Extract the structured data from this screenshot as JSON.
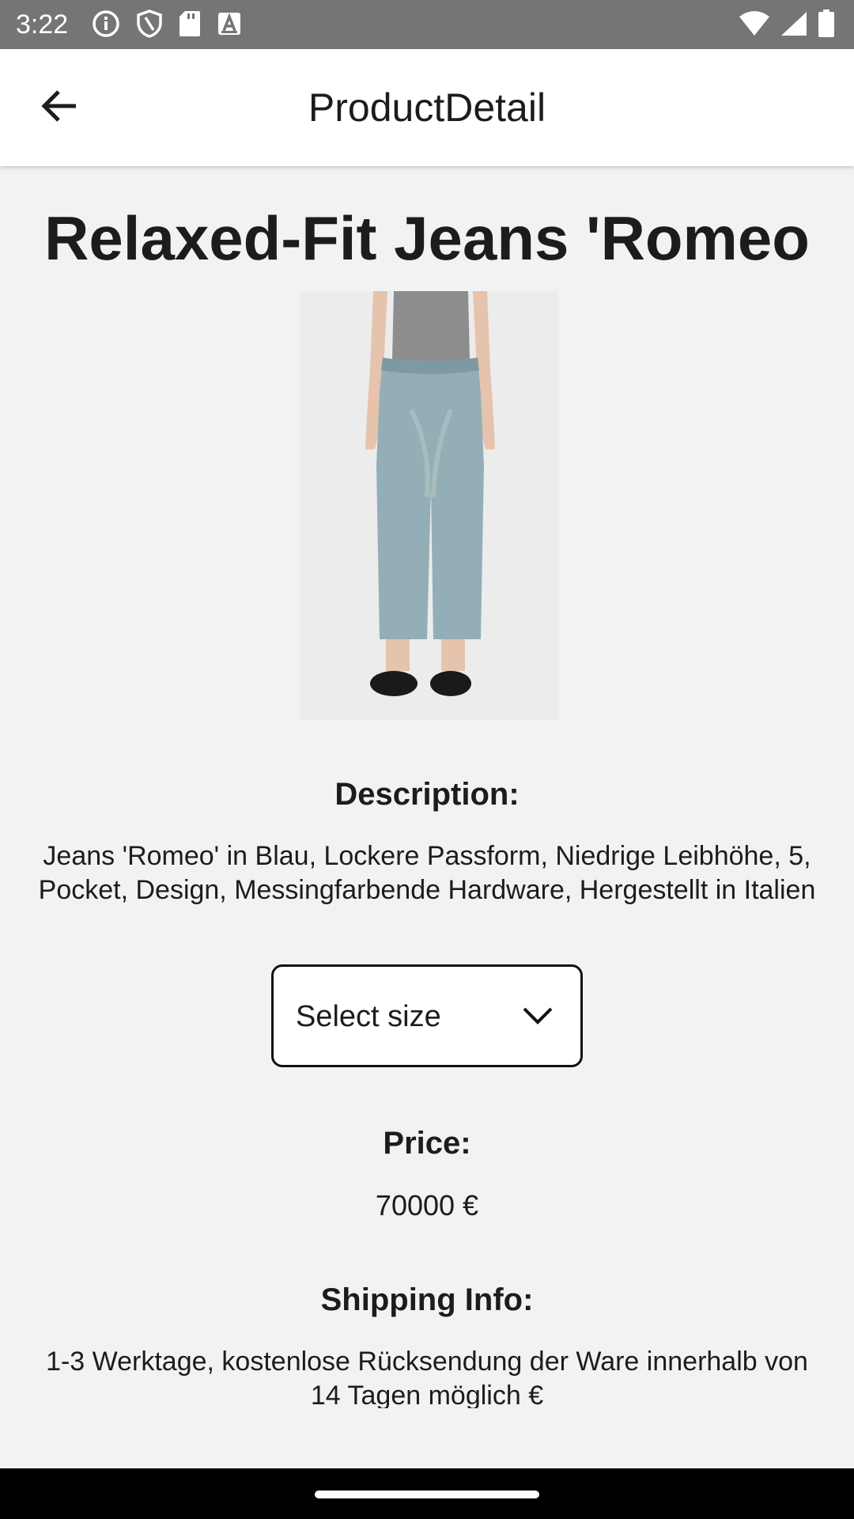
{
  "status_bar": {
    "time": "3:22",
    "left_icons": [
      "info-icon",
      "shield-icon",
      "sd-card-icon",
      "font-a-icon"
    ],
    "right_icons": [
      "wifi-icon",
      "signal-icon",
      "battery-icon"
    ]
  },
  "app_bar": {
    "title": "ProductDetail",
    "back_icon": "arrow-left-icon"
  },
  "product": {
    "title": "Relaxed-Fit Jeans 'Romeo",
    "image_alt": "jeans product photo",
    "description_heading": "Description:",
    "description": "Jeans 'Romeo' in Blau, Lockere Passform, Niedrige Leibhöhe, 5, Pocket, Design, Messingfarbende Hardware, Hergestellt in Italien",
    "size_select": {
      "label": "Select size",
      "icon": "chevron-down-icon"
    },
    "price_heading": "Price:",
    "price": "70000 €",
    "shipping_heading": "Shipping Info:",
    "shipping_info": "1-3 Werktage, kostenlose Rücksendung der Ware innerhalb von 14 Tagen möglich €"
  },
  "colors": {
    "status_bar": "#757575",
    "app_bar": "#ffffff",
    "background": "#f2f2f2",
    "text": "#1c1c1c",
    "nav_bar": "#000000"
  }
}
